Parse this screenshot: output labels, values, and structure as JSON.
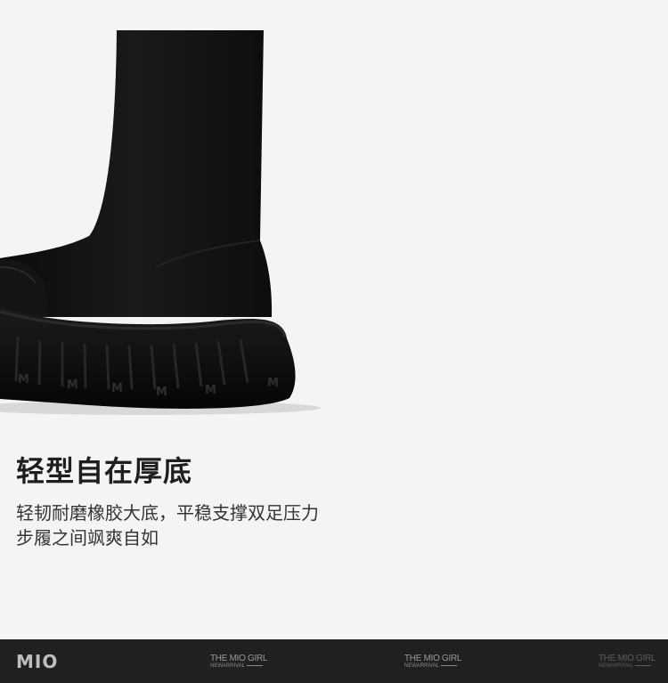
{
  "product": {
    "headline": "轻型自在厚底",
    "description_lines": [
      "轻韧耐磨橡胶大底，平稳支撑双足压力",
      "步履之间飒爽自如"
    ]
  },
  "footer": {
    "brand": "MIO",
    "tags": [
      {
        "title": "THE MIO GIRL",
        "subtitle": "NEWARRIVAL"
      },
      {
        "title": "THE MIO GIRL",
        "subtitle": "NEWARRIVAL"
      },
      {
        "title": "THE MIO GIRL",
        "subtitle": "NEWARRIVAL"
      }
    ]
  },
  "colors": {
    "background": "#f4f4f4",
    "boot": "#111111",
    "footer": "#202020"
  }
}
